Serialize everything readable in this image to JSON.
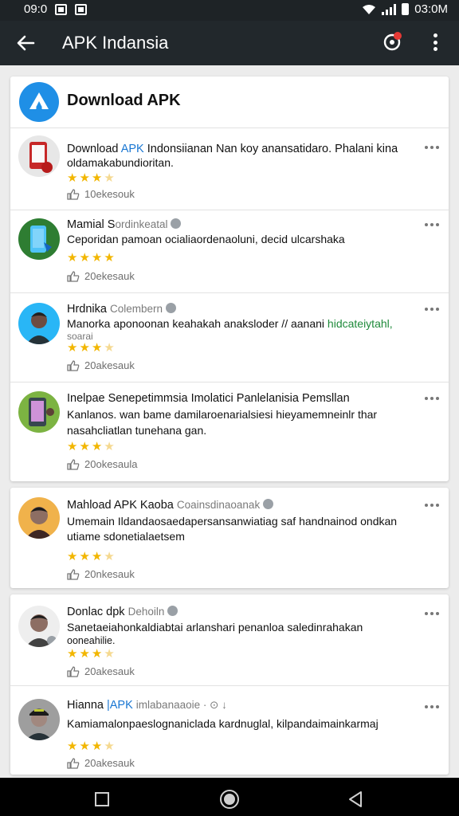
{
  "status_bar": {
    "left_text": "09:0",
    "time": "03:0M"
  },
  "app_bar": {
    "title": "APK Indansia"
  },
  "header_card": {
    "title": "Download APK"
  },
  "cards": [
    {
      "items": [
        {
          "name_pre": "Download ",
          "name_hl": "APK",
          "name_post": " Indonsiianan Nan koy anansatidaro. Phalani kina",
          "name_sub": "",
          "verified": false,
          "desc_1": "oldamakabundioritan.",
          "desc_2": "",
          "rating": 3,
          "likes": "10ekesouk"
        },
        {
          "name_pre": "Mamial S",
          "name_hl": "",
          "name_post": "",
          "name_sub": "ordinkeatal",
          "verified": true,
          "desc_1": "Ceporidan pamoan ocialiaordenaoluni, decid ulcarshaka",
          "desc_2": "",
          "rating": 4,
          "likes": "20ekesauk"
        },
        {
          "name_pre": "Hrdnika",
          "name_hl": "",
          "name_post": "",
          "name_sub": "Colembern",
          "verified": true,
          "desc_1": "Manorka aponoonan keahakah anaksloder // aanani ",
          "desc_1_green": "hidcateiytahl,",
          "desc_2": "soarai",
          "rating": 3,
          "likes": "20akesauk"
        },
        {
          "name_pre": "Inelpae Senepetimmsia Imolatici Panlelanisia Pemsllan",
          "name_hl": "",
          "name_post": "",
          "name_sub": "",
          "verified": false,
          "desc_1": "Kanlanos. wan bame damilaroenarialsiesi hieyamemneinlr thar",
          "desc_2": "nasahcliatlan tunehana gan.",
          "rating": 3,
          "likes": "20okesaula"
        }
      ]
    },
    {
      "items": [
        {
          "name_pre": "Mahload APK Kaoba",
          "name_hl": "",
          "name_post": " ",
          "name_sub": "Coainsdinaoanak",
          "verified": true,
          "desc_1": "Umemain Ildandaosaedapersansanwiatiag saf handnainod ondkan",
          "desc_2": "utiame sdonetialaetsem",
          "rating": 3,
          "likes": "20nkesauk"
        }
      ]
    },
    {
      "items": [
        {
          "name_pre": "Donlac dpk",
          "name_hl": "",
          "name_post": " ",
          "name_sub": "Dehoiln",
          "verified": true,
          "desc_1": "Sanetaeiahonkaldiabtai arlanshari penanloa saledinrahakan",
          "desc_2": "ooneahilie.",
          "rating": 3,
          "likes": "20akesauk"
        },
        {
          "name_pre": "Hianna ",
          "name_hl": "|APK",
          "name_post": " ",
          "name_sub": "imlabanaaoie · ⊙ ↓",
          "verified": false,
          "desc_1": "Kamiamalonpaeslognaniclada kardnuglal, kilpandaimainkarmaj",
          "desc_2": "",
          "rating": 3,
          "likes": "20akesauk"
        }
      ]
    }
  ],
  "colors": {
    "app_bar": "#22282c",
    "accent_blue": "#1f8fe6",
    "star": "#f2b600",
    "link": "#1976d2",
    "green": "#1e8a3a"
  }
}
